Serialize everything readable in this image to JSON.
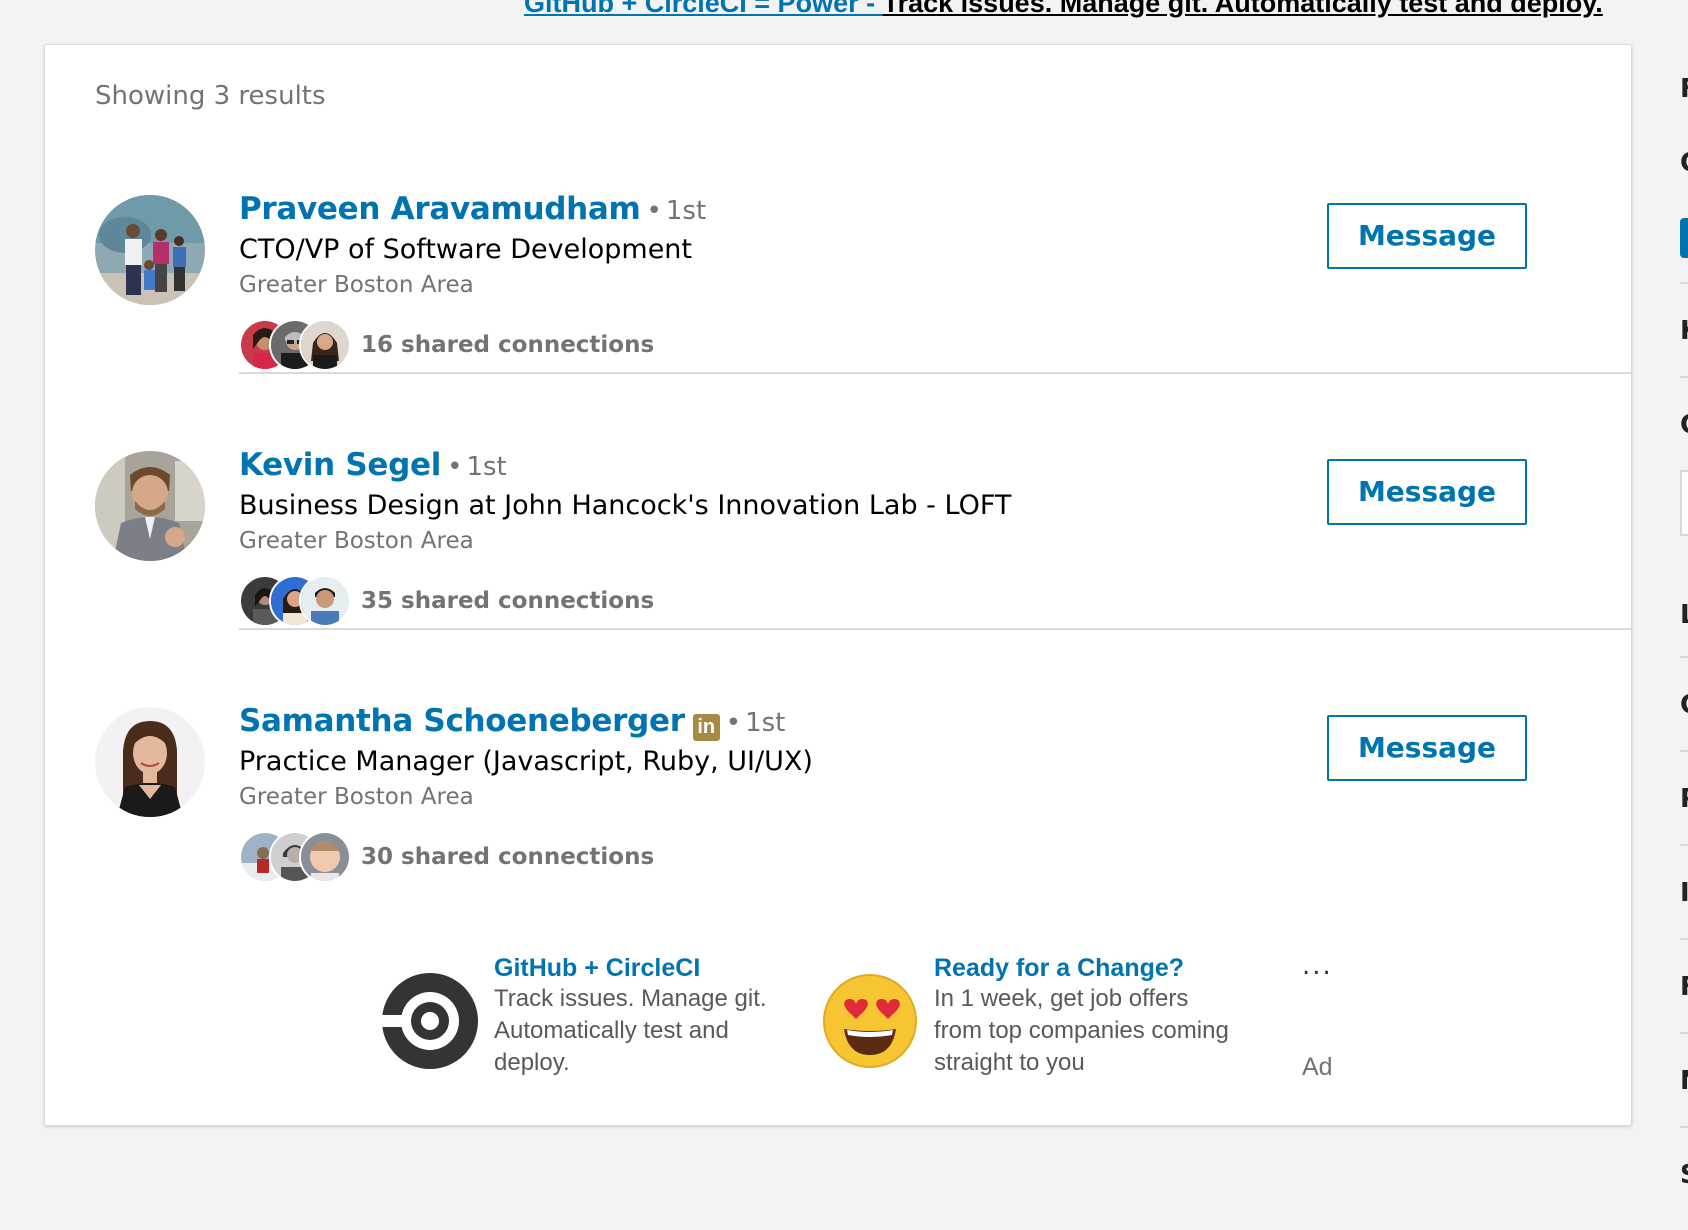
{
  "banner": {
    "link_text": "GitHub + CircleCI = Power - ",
    "text": "Track issues. Manage git. Automatically test and deploy."
  },
  "results_header": "Showing 3 results",
  "results": [
    {
      "name": "Praveen Aravamudham",
      "badge": null,
      "degree": "1st",
      "headline": "CTO/VP of Software Development",
      "location": "Greater Boston Area",
      "shared_connections": "16 shared connections",
      "action_label": "Message"
    },
    {
      "name": "Kevin Segel",
      "badge": null,
      "degree": "1st",
      "headline": "Business Design at John Hancock's Innovation Lab - LOFT",
      "location": "Greater Boston Area",
      "shared_connections": "35 shared connections",
      "action_label": "Message"
    },
    {
      "name": "Samantha Schoeneberger",
      "badge": "in",
      "degree": "1st",
      "headline": "Practice Manager (Javascript, Ruby, UI/UX)",
      "location": "Greater Boston Area",
      "shared_connections": "30 shared connections",
      "action_label": "Message"
    }
  ],
  "ads": [
    {
      "title": "GitHub + CircleCI",
      "description": "Track issues. Manage git. Automatically test and deploy.",
      "icon": "circleci-logo-icon"
    },
    {
      "title": "Ready for a Change?",
      "description": "In 1 week, get job offers from top companies coming straight to you",
      "icon": "heart-eyes-emoji-icon"
    }
  ],
  "ad_more_label": "...",
  "ad_label": "Ad",
  "sidebar_letters": [
    "F",
    "C",
    "K",
    "C",
    "L",
    "C",
    "P",
    "I",
    "F",
    "N",
    "S"
  ],
  "colors": {
    "link_blue": "#0073b1",
    "muted_gray": "#737373",
    "premium_gold": "#a68a44",
    "page_bg": "#f3f3f3"
  }
}
